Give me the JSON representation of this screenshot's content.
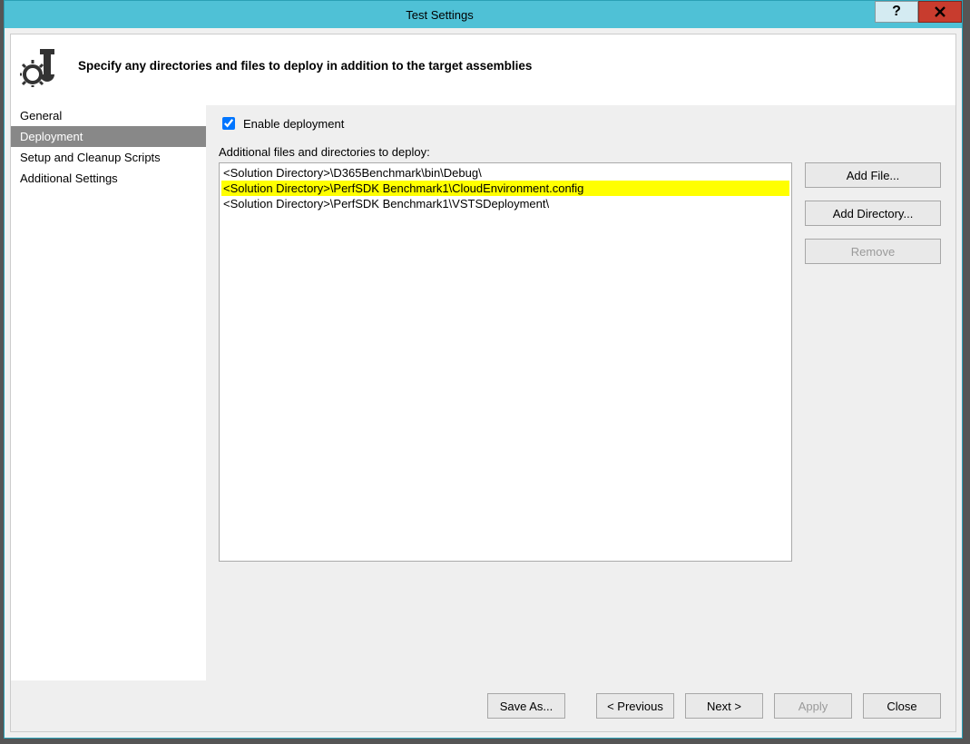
{
  "window": {
    "title": "Test Settings"
  },
  "header": {
    "title": "Specify any directories and files to deploy in addition to the target assemblies"
  },
  "sidebar": {
    "items": [
      {
        "label": "General",
        "selected": false
      },
      {
        "label": "Deployment",
        "selected": true
      },
      {
        "label": "Setup and Cleanup Scripts",
        "selected": false
      },
      {
        "label": "Additional Settings",
        "selected": false
      }
    ]
  },
  "main": {
    "enable_label": "Enable deployment",
    "enable_checked": true,
    "list_label": "Additional files and directories to deploy:",
    "items": [
      {
        "text": "<Solution Directory>\\D365Benchmark\\bin\\Debug\\",
        "highlight": false
      },
      {
        "text": "<Solution Directory>\\PerfSDK Benchmark1\\CloudEnvironment.config",
        "highlight": true
      },
      {
        "text": "<Solution Directory>\\PerfSDK Benchmark1\\VSTSDeployment\\",
        "highlight": false
      }
    ],
    "buttons": {
      "add_file": "Add File...",
      "add_directory": "Add Directory...",
      "remove": "Remove"
    }
  },
  "footer": {
    "save_as": "Save As...",
    "previous": "< Previous",
    "next": "Next >",
    "apply": "Apply",
    "close": "Close"
  }
}
